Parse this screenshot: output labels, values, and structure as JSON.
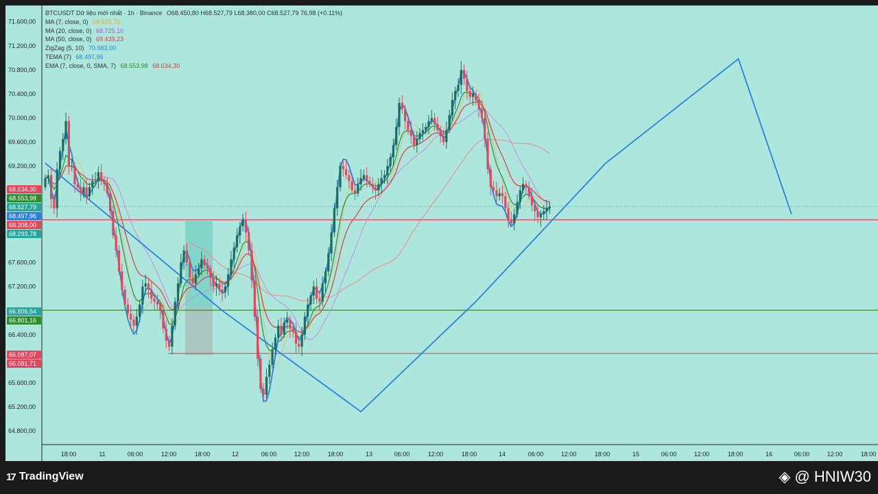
{
  "legend": {
    "symbol": "BTCUSDT Dữ liệu mới nhất · 1h · Binance",
    "ohlc": "O68.450,80 H68.527,79 L68.380,00 C68.527,79 76,98 (+0.11%)",
    "rows": [
      {
        "label": "MA (7, close, 0)",
        "value": "68.515,72",
        "color": "#f2a32b"
      },
      {
        "label": "MA (20, close, 0)",
        "value": "68.725,10",
        "color": "#c44fd1"
      },
      {
        "label": "MA (50, close, 0)",
        "value": "69.439,23",
        "color": "#e03a3a"
      },
      {
        "label": "ZigZag (5, 10)",
        "value": "70.983,00",
        "color": "#2a7fe0"
      },
      {
        "label": "TEMA (7)",
        "value": "68.497,96",
        "color": "#2a7fe0"
      },
      {
        "label": "EMA (7, close, 0, SMA, 7)",
        "value": "68.553,98",
        "value2": "68.634,30",
        "color": "#2e8b2e",
        "color2": "#e03a3a"
      }
    ]
  },
  "price_axis": {
    "ticks": [
      "71.600,00",
      "71.200,00",
      "70.800,00",
      "70.400,00",
      "70.000,00",
      "69.600,00",
      "69.200,00",
      "67.600,00",
      "67.200,00",
      "66.400,00",
      "65.600,00",
      "65.200,00",
      "64.800,00"
    ],
    "tick_values": [
      71600,
      71200,
      70800,
      70400,
      70000,
      69600,
      69200,
      67600,
      67200,
      66400,
      65600,
      65200,
      64800
    ],
    "labels": [
      {
        "text": "68.634,30",
        "value": 68634.3,
        "color": "#e8445a"
      },
      {
        "text": "68.553,98",
        "value": 68553.98,
        "color": "#2e8b2e"
      },
      {
        "text": "68.527,79",
        "value": 68527.79,
        "color": "#26a69a"
      },
      {
        "text": "68.497,96",
        "value": 68497.96,
        "color": "#2a7fe0"
      },
      {
        "text": "68.308,00",
        "value": 68308.0,
        "color": "#e8445a"
      },
      {
        "text": "68.293,78",
        "value": 68293.78,
        "color": "#26a69a"
      },
      {
        "text": "66.806,54",
        "value": 66806.54,
        "color": "#26a69a"
      },
      {
        "text": "66.801,16",
        "value": 66801.16,
        "color": "#2e8b2e"
      },
      {
        "text": "66.087,07",
        "value": 66087.07,
        "color": "#e8445a"
      },
      {
        "text": "66.081,71",
        "value": 66081.71,
        "color": "#e8445a"
      }
    ]
  },
  "time_axis": {
    "ticks": [
      "18:00",
      "11",
      "06:00",
      "12:00",
      "18:00",
      "12",
      "06:00",
      "12:00",
      "18:00",
      "13",
      "06:00",
      "12:00",
      "18:00",
      "14",
      "06:00",
      "12:00",
      "18:00",
      "15",
      "06:00",
      "12:00",
      "18:00",
      "16",
      "06:00",
      "12:00",
      "18:00"
    ]
  },
  "chart_data": {
    "type": "candlestick",
    "symbol": "BTCUSDT",
    "interval": "1h",
    "ylim": [
      64600,
      71900
    ],
    "hlines": [
      {
        "value": 68308,
        "color": "#e8445a"
      },
      {
        "value": 66806.54,
        "color": "#2e8b2e"
      },
      {
        "value": 66087.07,
        "color": "#e8445a"
      }
    ],
    "zigzag": [
      [
        0,
        69250
      ],
      [
        60,
        66800
      ],
      [
        107,
        65120
      ],
      [
        146,
        66950
      ],
      [
        190,
        69250
      ],
      [
        235,
        70983
      ],
      [
        253,
        68400
      ]
    ],
    "closes": [
      69000,
      69050,
      68650,
      68500,
      69150,
      69450,
      69650,
      69950,
      69200,
      69200,
      68900,
      68850,
      68750,
      68850,
      68700,
      68850,
      68950,
      68950,
      69100,
      68950,
      68900,
      68750,
      68450,
      68050,
      67800,
      67450,
      67150,
      66900,
      66750,
      66650,
      66550,
      66700,
      66900,
      67200,
      67250,
      67150,
      67000,
      66950,
      66900,
      66800,
      66500,
      66300,
      66200,
      66550,
      66950,
      67250,
      67600,
      67800,
      67600,
      67350,
      67250,
      67400,
      67500,
      67650,
      67550,
      67500,
      67350,
      67200,
      67250,
      67150,
      67100,
      67200,
      67400,
      67650,
      67850,
      68050,
      68200,
      68300,
      68100,
      67800,
      67300,
      66700,
      66000,
      65500,
      65400,
      65700,
      65900,
      66150,
      66350,
      66550,
      66400,
      66600,
      66650,
      66500,
      66450,
      66250,
      66200,
      66400,
      66700,
      66900,
      67050,
      67200,
      67000,
      66950,
      67250,
      67450,
      67750,
      68100,
      68500,
      68850,
      69200,
      69150,
      69050,
      68950,
      68800,
      68750,
      68900,
      69000,
      69050,
      68950,
      68900,
      68850,
      68800,
      68900,
      69000,
      69050,
      69200,
      69350,
      69550,
      69850,
      70250,
      70150,
      69950,
      69800,
      69700,
      69550,
      69650,
      69750,
      69800,
      69850,
      69950,
      70000,
      69900,
      69800,
      69700,
      69600,
      69800,
      70050,
      70300,
      70450,
      70550,
      70800,
      70650,
      70450,
      70350,
      70400,
      70300,
      70150,
      70000,
      69650,
      69150,
      68850,
      68800,
      68700,
      68750,
      68700,
      68500,
      68300,
      68250,
      68400,
      68600,
      68800,
      68900,
      68850,
      68700,
      68550,
      68450,
      68350,
      68400,
      68450,
      68500,
      68527.79
    ],
    "series": [
      {
        "name": "MA (7, close, 0)",
        "period": 7,
        "type": "sma",
        "color": "#d8c27a"
      },
      {
        "name": "MA (20, close, 0)",
        "period": 20,
        "type": "sma",
        "color": "#c98ae0"
      },
      {
        "name": "MA (50, close, 0)",
        "period": 50,
        "type": "sma",
        "color": "#e88a8a"
      },
      {
        "name": "EMA (7, close, 0, SMA, 7)",
        "period": 7,
        "type": "ema",
        "color": "#2e8b2e"
      },
      {
        "name": "EMA (7, close, 0, SMA, 7)",
        "period": 14,
        "type": "ema",
        "color": "#e03a3a"
      },
      {
        "name": "TEMA (7)",
        "period": 7,
        "type": "tema",
        "color": "#2a7fe0"
      },
      {
        "name": "ZigZag (5, 10)",
        "type": "zigzag",
        "color": "#2a7fe0"
      }
    ]
  },
  "footer": {
    "brand": "TradingView",
    "watermark": "@ HNIW30"
  },
  "colors": {
    "up": "#26a69a",
    "up_dark": "#1e6b5f",
    "down": "#e8445a",
    "background": "#ade6dc"
  }
}
